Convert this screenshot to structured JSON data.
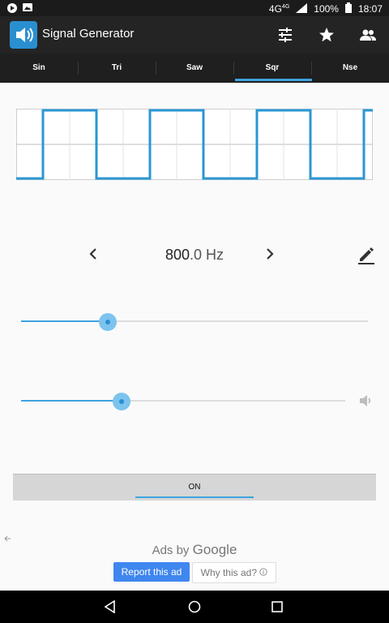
{
  "status": {
    "network": "4G",
    "network_sup": "4G",
    "battery": "100%",
    "time": "18:07"
  },
  "app": {
    "title": "Signal Generator",
    "accent": "#3fa3df"
  },
  "tabs": [
    {
      "label": "Sin"
    },
    {
      "label": "Tri"
    },
    {
      "label": "Saw"
    },
    {
      "label": "Sqr",
      "selected": true
    },
    {
      "label": "Nse"
    }
  ],
  "frequency": {
    "int_part": "800",
    "dec_part": ".0 Hz",
    "prev_icon": "chevron-left-icon",
    "next_icon": "chevron-right-icon",
    "edit_icon": "pencil-icon"
  },
  "frequency_slider": {
    "level": 0.25
  },
  "volume_slider": {
    "level": 0.31,
    "icon": "speaker-icon"
  },
  "power": {
    "label": "ON"
  },
  "ads": {
    "by_text": "Ads by",
    "brand": "Google",
    "report_label": "Report this ad",
    "why_label": "Why this ad?"
  }
}
